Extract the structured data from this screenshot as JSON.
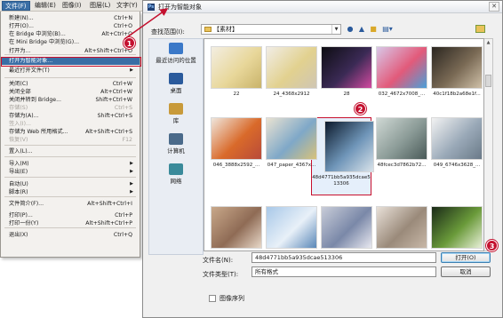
{
  "menubar": [
    {
      "label": "文件(F)",
      "active": true
    },
    {
      "label": "编辑(E)"
    },
    {
      "label": "图像(I)"
    },
    {
      "label": "图层(L)"
    },
    {
      "label": "文字(Y)"
    }
  ],
  "file_menu": [
    {
      "label": "新建(N)...",
      "shortcut": "Ctrl+N"
    },
    {
      "label": "打开(O)...",
      "shortcut": "Ctrl+O"
    },
    {
      "label": "在 Bridge 中浏览(B)...",
      "shortcut": "Alt+Ctrl+O"
    },
    {
      "label": "在 Mini Bridge 中浏览(G)..."
    },
    {
      "label": "打开为...",
      "shortcut": "Alt+Shift+Ctrl+O"
    },
    {
      "label": "打开为智能对象...",
      "highlighted": true
    },
    {
      "label": "最近打开文件(T)",
      "submenu": true
    },
    {
      "label": "关闭(C)",
      "shortcut": "Ctrl+W"
    },
    {
      "label": "关闭全部",
      "shortcut": "Alt+Ctrl+W"
    },
    {
      "label": "关闭并转到 Bridge...",
      "shortcut": "Shift+Ctrl+W"
    },
    {
      "label": "存储(S)",
      "shortcut": "Ctrl+S",
      "disabled": true
    },
    {
      "label": "存储为(A)...",
      "shortcut": "Shift+Ctrl+S"
    },
    {
      "label": "签入(I)...",
      "disabled": true
    },
    {
      "label": "存储为 Web 所用格式...",
      "shortcut": "Alt+Shift+Ctrl+S"
    },
    {
      "label": "恢复(V)",
      "shortcut": "F12",
      "disabled": true
    },
    {
      "label": "置入(L)..."
    },
    {
      "label": "导入(M)",
      "submenu": true
    },
    {
      "label": "导出(E)",
      "submenu": true
    },
    {
      "label": "自动(U)",
      "submenu": true
    },
    {
      "label": "脚本(R)",
      "submenu": true
    },
    {
      "label": "文件简介(F)...",
      "shortcut": "Alt+Shift+Ctrl+I"
    },
    {
      "label": "打印(P)...",
      "shortcut": "Ctrl+P"
    },
    {
      "label": "打印一份(Y)",
      "shortcut": "Alt+Shift+Ctrl+P"
    },
    {
      "label": "退出(X)",
      "shortcut": "Ctrl+Q"
    }
  ],
  "badges": {
    "b1": "1",
    "b2": "2",
    "b3": "3"
  },
  "dialog": {
    "title": "打开为智能对象",
    "look_in_label": "查找范围(I):",
    "look_in_value": "【素材】",
    "close_glyph": "✕",
    "places": [
      {
        "label": "最近访问的位置",
        "icon": "recent-places-icon"
      },
      {
        "label": "桌面",
        "icon": "desktop-icon"
      },
      {
        "label": "库",
        "icon": "library-icon"
      },
      {
        "label": "计算机",
        "icon": "computer-icon"
      },
      {
        "label": "网络",
        "icon": "network-icon"
      }
    ],
    "files": [
      {
        "name": "22",
        "colors": [
          "#f3eee2",
          "#e8d79a",
          "#c9b36a"
        ]
      },
      {
        "name": "24_4368x2912",
        "colors": [
          "#f1ede6",
          "#e2d18f",
          "#cfc6b4"
        ]
      },
      {
        "name": "28",
        "colors": [
          "#0d0d12",
          "#3b2a55",
          "#d24aa0"
        ]
      },
      {
        "name": "032_4672x7008_...",
        "colors": [
          "#d8c7e8",
          "#e25a7a",
          "#4aa0d8"
        ]
      },
      {
        "name": "40c1f18b2a68e1f...",
        "colors": [
          "#2b2620",
          "#7a6a55",
          "#cfc0a8"
        ]
      },
      {
        "name": "046_3888x2592_...",
        "colors": [
          "#efe6dc",
          "#d96a2a",
          "#b84a3a"
        ]
      },
      {
        "name": "047_paper_4367x...",
        "colors": [
          "#e9e2d2",
          "#7fa8c8",
          "#d8c27a"
        ]
      },
      {
        "name": "48d4771bb5a935dcae513306",
        "colors": [
          "#0c1a2c",
          "#6f95b8",
          "#d9e3ea"
        ],
        "selected": true
      },
      {
        "name": "48fcec3d7862b72...",
        "colors": [
          "#cfd8d4",
          "#8a9a96",
          "#4a5a58"
        ]
      },
      {
        "name": "049_6746x3628_...",
        "colors": [
          "#f2f2f2",
          "#9aa9b8",
          "#6a7a88"
        ]
      },
      {
        "name": "",
        "colors": [
          "#c8a88a",
          "#8f6b55",
          "#e8d8c8"
        ]
      },
      {
        "name": "",
        "colors": [
          "#a8c8e8",
          "#e8f0f8",
          "#5a88b8"
        ]
      },
      {
        "name": "",
        "colors": [
          "#c8ccd8",
          "#7a88a8",
          "#e8e8f0"
        ]
      },
      {
        "name": "",
        "colors": [
          "#e8e0d8",
          "#9a8a7a",
          "#c8b8a8"
        ]
      },
      {
        "name": "",
        "colors": [
          "#1a2a18",
          "#6a9a3a",
          "#e8f0d8"
        ]
      }
    ],
    "file_name_label": "文件名(N):",
    "file_name_value": "48d4771bb5a935dcae513306",
    "file_type_label": "文件类型(T):",
    "file_type_value": "所有格式",
    "open_button": "打开(O)",
    "cancel_button": "取消",
    "image_sequence_label": "图像序列"
  }
}
